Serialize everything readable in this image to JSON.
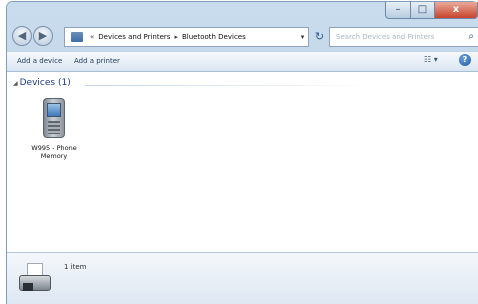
{
  "window": {
    "caption_buttons": {
      "minimize": "–",
      "maximize": "□",
      "close": "x"
    }
  },
  "nav": {
    "back_glyph": "◀",
    "forward_glyph": "▶",
    "address_overflow": "«",
    "breadcrumb": [
      "Devices and Printers",
      "Bluetooth Devices"
    ],
    "separator": "▸",
    "dropdown_glyph": "▾",
    "refresh_glyph": "↻",
    "search_placeholder": "Search Devices and Printers",
    "search_icon": "⌕"
  },
  "toolbar": {
    "add_device": "Add a device",
    "add_printer": "Add a printer",
    "view_glyph": "☷ ▾",
    "help_glyph": "?"
  },
  "content": {
    "group_toggle": "◢",
    "group_label": "Devices (1)",
    "device_label_line1": "W995 - Phone",
    "device_label_line2": "Memory"
  },
  "details": {
    "item_count": "1 item"
  }
}
